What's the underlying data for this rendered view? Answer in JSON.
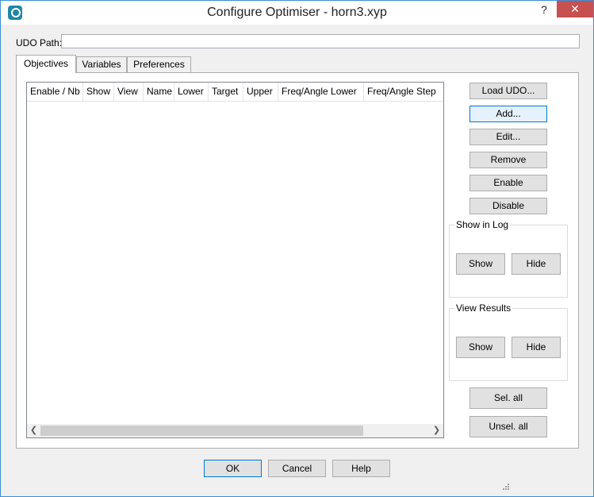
{
  "window": {
    "title": "Configure Optimiser - horn3.xyp",
    "help_label": "?",
    "close_label": "✕"
  },
  "udo": {
    "label": "UDO Path:",
    "value": ""
  },
  "tabs": [
    {
      "label": "Objectives",
      "active": true
    },
    {
      "label": "Variables",
      "active": false
    },
    {
      "label": "Preferences",
      "active": false
    }
  ],
  "table": {
    "columns": [
      "Enable / Nb",
      "Show",
      "View",
      "Name",
      "Lower",
      "Target",
      "Upper",
      "Freq/Angle Lower",
      "Freq/Angle Step"
    ],
    "rows": []
  },
  "side_buttons": {
    "load_udo": "Load UDO...",
    "add": "Add...",
    "edit": "Edit...",
    "remove": "Remove",
    "enable": "Enable",
    "disable": "Disable"
  },
  "show_in_log": {
    "label": "Show in Log",
    "show": "Show",
    "hide": "Hide"
  },
  "view_results": {
    "label": "View Results",
    "show": "Show",
    "hide": "Hide"
  },
  "selection": {
    "select_all": "Sel. all",
    "unselect_all": "Unsel. all"
  },
  "footer": {
    "ok": "OK",
    "cancel": "Cancel",
    "help": "Help"
  },
  "colors": {
    "accent": "#0078d7",
    "close_button": "#c75050",
    "dialog_bg": "#f0f0f0"
  }
}
